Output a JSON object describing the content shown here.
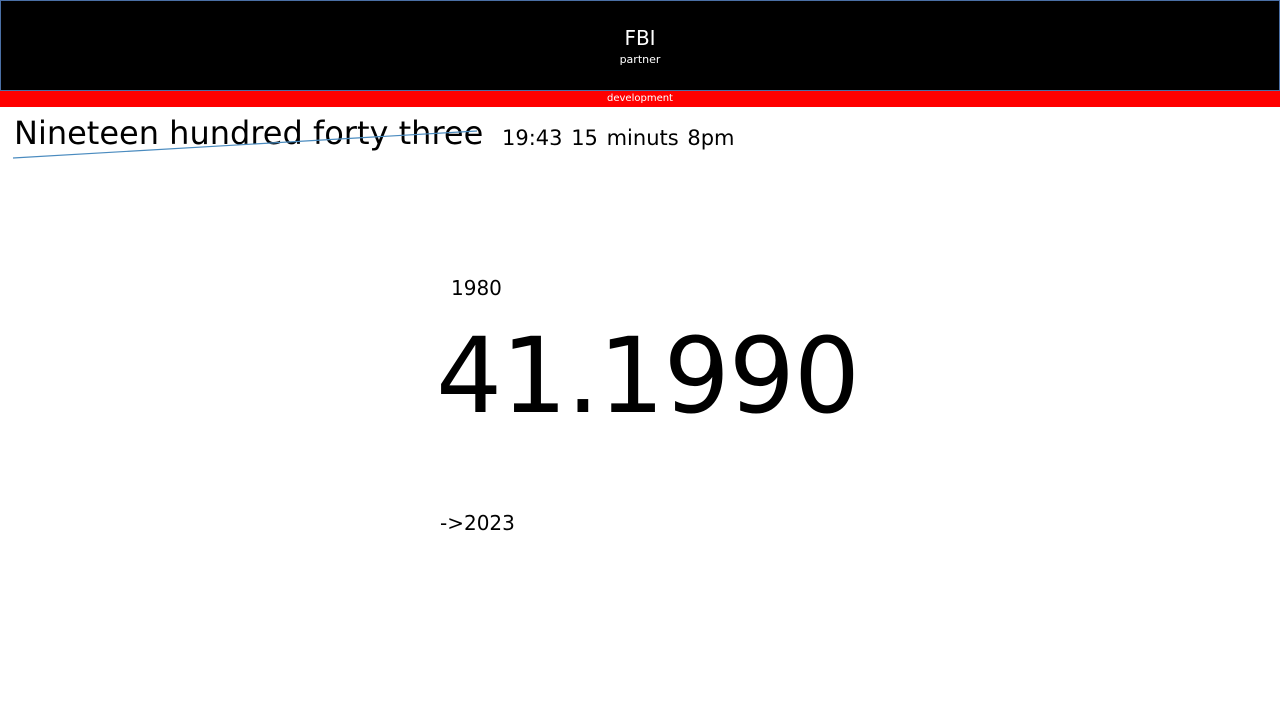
{
  "header": {
    "title": "FBI",
    "subtitle": "partner",
    "background_color": "#000000",
    "border_color": "#4a6fa5"
  },
  "banner": {
    "label": "development",
    "color": "#ff0000"
  },
  "content": {
    "words_line": "Nineteen hundred forty three",
    "time_line": "19:43 15 minuts 8pm",
    "year_small": "1980",
    "big_number": "41.1990",
    "arrow_year": "->2023",
    "strike_color": "#4a8bbf"
  }
}
